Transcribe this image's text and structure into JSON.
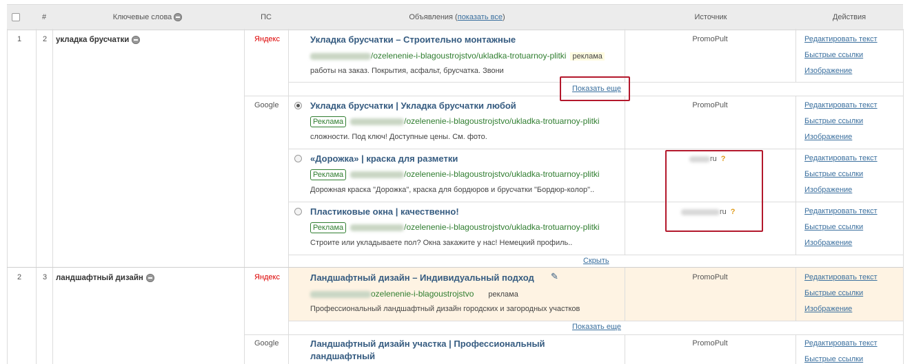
{
  "header": {
    "num": "#",
    "keywords": "Ключевые слова",
    "ps": "ПС",
    "ads_prefix": "Объявления (",
    "show_all": "показать все",
    "ads_suffix": ")",
    "source": "Источник",
    "actions": "Действия"
  },
  "groups": [
    {
      "row": "1",
      "id": "2",
      "keyword": "укладка брусчатки",
      "yandex_label": "Яндекс",
      "yandex_ad": {
        "title": "Укладка брусчатки – Строительно монтажные",
        "url_path": "/ozelenenie-i-blagoustrojstvo/ukladka-trotuarnoy-plitki",
        "tag": "реклама",
        "desc": "работы на заказ. Покрытия, асфальт, брусчатка. Звони",
        "source": "PromoPult"
      },
      "show_more": "Показать еще",
      "google_label": "Google",
      "google_ads": [
        {
          "title": "Укладка брусчатки |  Укладка брусчатки любой",
          "badge": "Реклама",
          "url_path": "/ozelenenie-i-blagoustrojstvo/ukladka-trotuarnoy-plitki",
          "desc": "сложности. Под ключ! Доступные цены. См. фото.",
          "source": "PromoPult",
          "selected": true
        },
        {
          "title": "«Дорожка» | краска для разметки",
          "badge": "Реклама",
          "url_path": "/ozelenenie-i-blagoustrojstvo/ukladka-trotuarnoy-plitki",
          "desc": "Дорожная краска \"Дорожка\", краска для бордюров и брусчатки \"Бордюр-колор\"..",
          "source": "ru",
          "q": "?",
          "selected": false
        },
        {
          "title": "Пластиковые окна | качественно!",
          "badge": "Реклама",
          "url_path": "/ozelenenie-i-blagoustrojstvo/ukladka-trotuarnoy-plitki",
          "desc": "Строите или укладываете пол? Окна закажите у нас! Немецкий профиль..",
          "source": "ru",
          "q": "?",
          "selected": false
        }
      ],
      "hide": "Скрыть"
    },
    {
      "row": "2",
      "id": "3",
      "keyword": "ландшафтный дизайн",
      "yandex_label": "Яндекс",
      "yandex_ad": {
        "title": "Ландшафтный дизайн – Индивидуальный подход",
        "url_path": "ozelenenie-i-blagoustrojstvo",
        "tag": "реклама",
        "desc": "Профессиональный ландшафтный дизайн городских и загородных участков",
        "source": "PromoPult"
      },
      "show_more": "Показать еще",
      "google_label": "Google",
      "google_ad": {
        "title_line1": "Ландшафтный дизайн участка |  Профессиональный",
        "title_line2": "ландшафтный",
        "source": "PromoPult"
      }
    }
  ],
  "actions": {
    "edit": "Редактировать текст",
    "quick_links": "Быстрые ссылки",
    "image": "Изображение"
  },
  "colors": {
    "highlight_row": "#fef3e3",
    "red_box": "#b3172b",
    "title": "#355b80",
    "url": "#2f7d2f"
  }
}
